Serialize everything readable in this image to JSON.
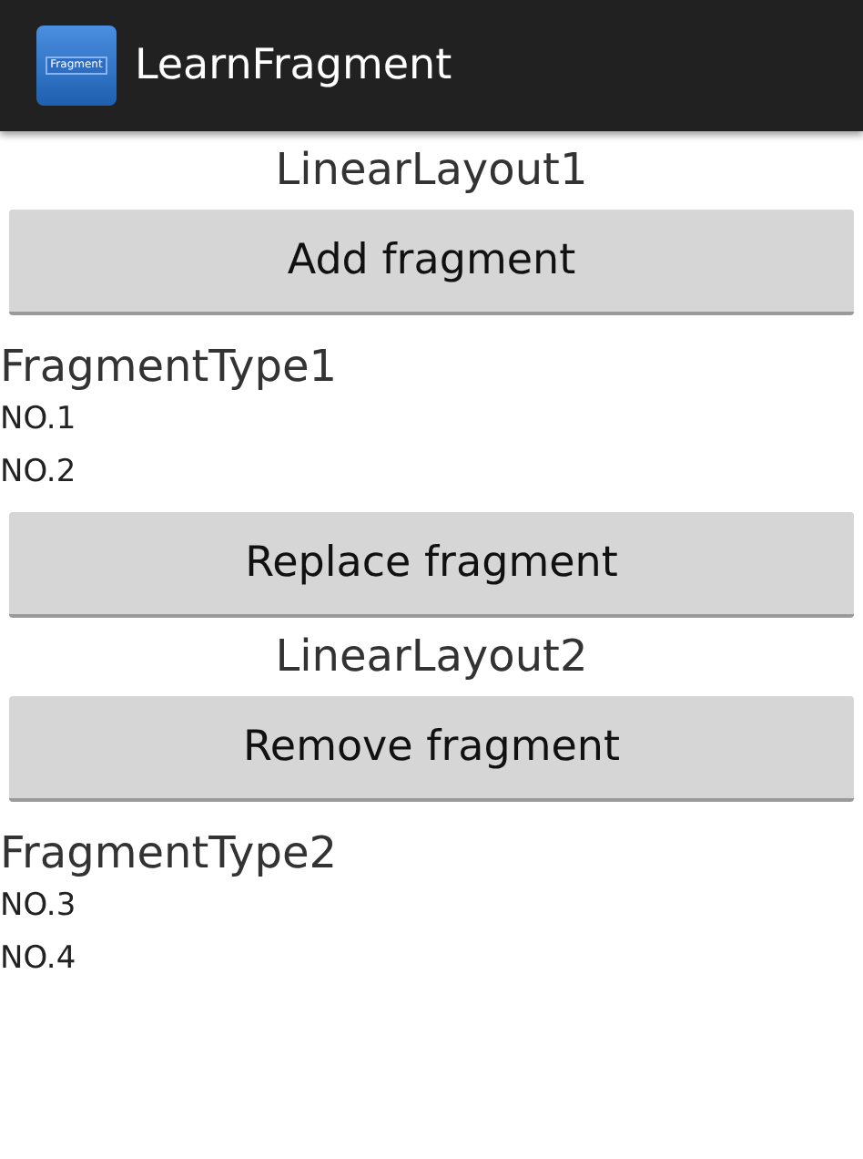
{
  "action_bar": {
    "icon_text": "Fragment",
    "title": "LearnFragment"
  },
  "items": [
    {
      "kind": "heading",
      "text": "LinearLayout1"
    },
    {
      "kind": "button",
      "text": "Add fragment"
    },
    {
      "kind": "fragment_title",
      "text": "FragmentType1"
    },
    {
      "kind": "line",
      "text": "NO.1"
    },
    {
      "kind": "line",
      "text": "NO.2"
    },
    {
      "kind": "button",
      "text": "Replace fragment"
    },
    {
      "kind": "heading",
      "text": "LinearLayout2"
    },
    {
      "kind": "button",
      "text": "Remove fragment"
    },
    {
      "kind": "fragment_title",
      "text": "FragmentType2"
    },
    {
      "kind": "line",
      "text": "NO.3"
    },
    {
      "kind": "line",
      "text": "NO.4"
    }
  ]
}
